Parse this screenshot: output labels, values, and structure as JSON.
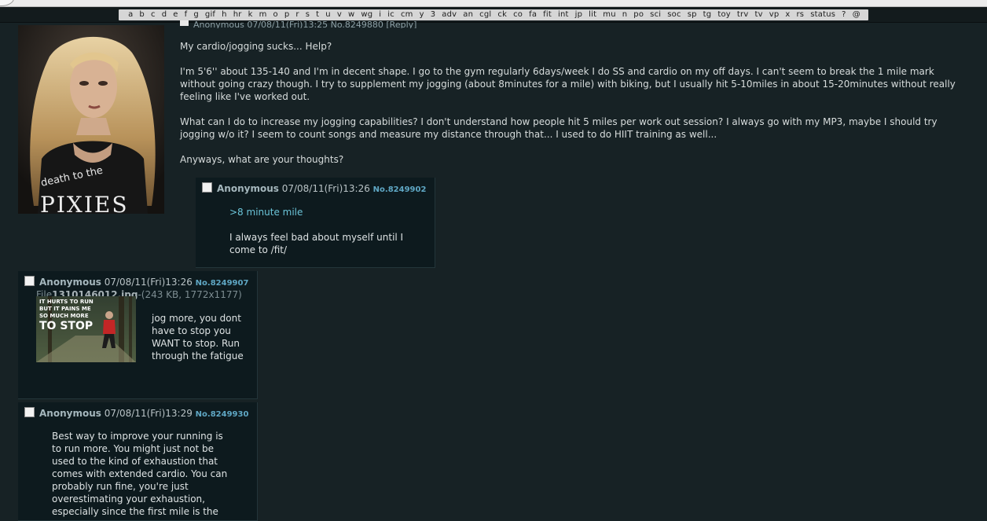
{
  "nav": {
    "boards": [
      "a",
      "b",
      "c",
      "d",
      "e",
      "f",
      "g",
      "gif",
      "h",
      "hr",
      "k",
      "m",
      "o",
      "p",
      "r",
      "s",
      "t",
      "u",
      "v",
      "w",
      "wg",
      "i",
      "ic",
      "cm",
      "y",
      "3",
      "adv",
      "an",
      "cgl",
      "ck",
      "co",
      "fa",
      "fit",
      "int",
      "jp",
      "lit",
      "mu",
      "n",
      "po",
      "sci",
      "soc",
      "sp",
      "tg",
      "toy",
      "trv",
      "tv",
      "vp",
      "x",
      "rs",
      "status",
      "?",
      "@"
    ]
  },
  "op": {
    "header_text": "Anonymous 07/08/11(Fri)13:25 No.8249880 [Reply]",
    "subject": "My cardio/jogging sucks... Help?",
    "paragraphs": [
      "I'm 5'6'' about 135-140 and I'm in decent shape. I go to the gym regularly 6days/week I do SS and cardio on my off days. I can't seem to break the 1 mile mark without going crazy though. I try to supplement my jogging (about 8minutes for a mile) with biking, but I usually hit 5-10miles in about 15-20minutes without really feeling like I've worked out.",
      "What can I do to increase my jogging capabilities? I don't understand how people hit 5 miles per work out session? I always go with my MP3, maybe I should try jogging w/o it? I seem to count songs and measure my distance through that... I used to do HIIT training as well...",
      "Anyways, what are your thoughts?"
    ],
    "image_text": "death to the PIXIES"
  },
  "reply1": {
    "name": "Anonymous",
    "date": "07/08/11(Fri)13:26",
    "postno": "No.8249902",
    "quote": ">8 minute mile",
    "text": "I always feel bad about myself until I come to /fit/"
  },
  "reply2": {
    "name": "Anonymous",
    "date": "07/08/11(Fri)13:26",
    "postno": "No.8249907",
    "file_label": "File",
    "file_name": "1310146012.jpg",
    "file_meta": "-(243 KB, 1772x1177)",
    "image_caption": "IT HURTS TO RUN BUT IT PAINS ME SO MUCH MORE TO STOP",
    "text": "jog more, you dont have to stop you WANT to stop. Run through the fatigue"
  },
  "reply3": {
    "name": "Anonymous",
    "date": "07/08/11(Fri)13:29",
    "postno": "No.8249930",
    "text": "Best way to improve your running is to run more. You might just not be used to the kind of exhaustion that comes with extended cardio. You can probably run fine, you're just overestimating your exhaustion, especially since the first mile is the"
  }
}
